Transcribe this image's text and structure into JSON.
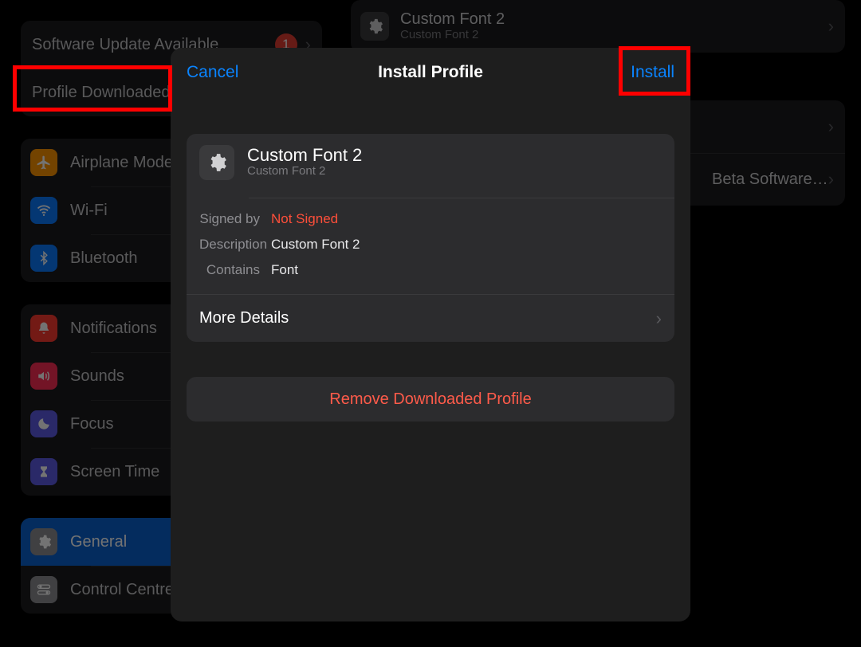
{
  "sidebar": {
    "top_group": [
      {
        "label": "Software Update Available",
        "badge": "1"
      },
      {
        "label": "Profile Downloaded"
      }
    ],
    "network_group": [
      {
        "label": "Airplane Mode",
        "icon": "airplane",
        "bg": "#ff9500"
      },
      {
        "label": "Wi-Fi",
        "icon": "wifi",
        "bg": "#0a7aff"
      },
      {
        "label": "Bluetooth",
        "icon": "bluetooth",
        "bg": "#0a7aff"
      }
    ],
    "alerts_group": [
      {
        "label": "Notifications",
        "icon": "bell",
        "bg": "#ff3b30"
      },
      {
        "label": "Sounds",
        "icon": "speaker",
        "bg": "#ff2d55"
      },
      {
        "label": "Focus",
        "icon": "moon",
        "bg": "#5e5ce6"
      },
      {
        "label": "Screen Time",
        "icon": "hourglass",
        "bg": "#5e5ce6"
      }
    ],
    "system_group": [
      {
        "label": "General",
        "icon": "gear",
        "bg": "#8e8e93",
        "selected": true
      },
      {
        "label": "Control Centre",
        "icon": "toggles",
        "bg": "#8e8e93"
      }
    ]
  },
  "content_behind": {
    "profile_item": {
      "title": "Custom Font 2",
      "subtitle": "Custom Font 2"
    },
    "blank_item": "",
    "beta_item": "Beta Software…"
  },
  "modal": {
    "cancel": "Cancel",
    "title": "Install Profile",
    "install": "Install",
    "profile": {
      "title": "Custom Font 2",
      "subtitle": "Custom Font 2",
      "signed_by_label": "Signed by",
      "signed_by_value": "Not Signed",
      "description_label": "Description",
      "description_value": "Custom Font 2",
      "contains_label": "Contains",
      "contains_value": "Font"
    },
    "more_details": "More Details",
    "remove": "Remove Downloaded Profile"
  }
}
